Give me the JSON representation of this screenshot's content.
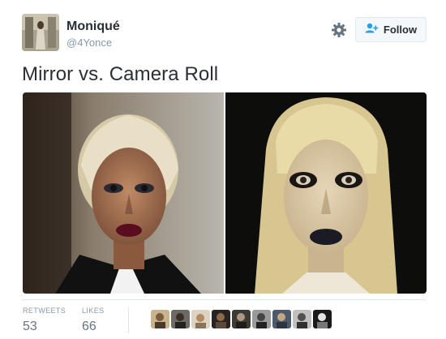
{
  "header": {
    "display_name": "Moniqué",
    "handle": "@4Yonce",
    "follow_label": "Follow"
  },
  "tweet": {
    "text": "Mirror vs. Camera Roll"
  },
  "stats": {
    "retweets_label": "RETWEETS",
    "retweets_value": "53",
    "likes_label": "LIKES",
    "likes_value": "66"
  },
  "icons": {
    "settings": "gear-icon",
    "follow": "add-user-icon"
  },
  "colors": {
    "accent": "#1da1f2",
    "muted": "#8899a6",
    "text": "#292f33"
  },
  "liker_avatars_count_visible": 9
}
